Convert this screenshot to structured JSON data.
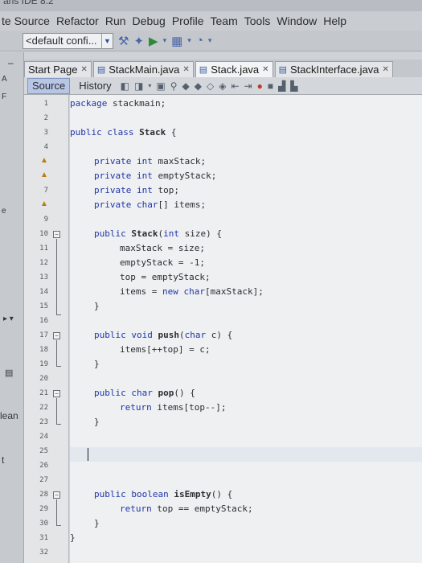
{
  "window_title": "ans IDE 8.2",
  "menu": [
    "te Source",
    "Refactor",
    "Run",
    "Debug",
    "Profile",
    "Team",
    "Tools",
    "Window",
    "Help"
  ],
  "toolbar": {
    "config_value": "<default confi..."
  },
  "left_panel": {
    "label_lean": "lean",
    "label_t": "t",
    "label_e": "e",
    "label_f": "F",
    "label_a": "A"
  },
  "tabs": [
    "Start Page",
    "StackMain.java",
    "Stack.java",
    "StackInterface.java"
  ],
  "editor_tabs": {
    "source": "Source",
    "history": "History"
  },
  "code": {
    "line_numbers": [
      "1",
      "2",
      "3",
      "4",
      "5",
      "6",
      "7",
      "8",
      "9",
      "10",
      "11",
      "12",
      "13",
      "14",
      "15",
      "16",
      "17",
      "18",
      "19",
      "20",
      "21",
      "22",
      "23",
      "24",
      "25",
      "26",
      "27",
      "28",
      "29",
      "30",
      "31",
      "32"
    ],
    "l1_kw": "package",
    "l1_rest": " stackmain;",
    "l3_kw": "public class",
    "l3_name": " Stack",
    "l3_rest": " {",
    "l5_kw": "private int",
    "l5_rest": " maxStack;",
    "l6_kw": "private int",
    "l6_rest": " emptyStack;",
    "l7_kw": "private int",
    "l7_rest": " top;",
    "l8_kw": "private char",
    "l8_rest": "[] items;",
    "l10_kw": "public",
    "l10_name": " Stack",
    "l10_mid": "(",
    "l10_kw2": "int",
    "l10_rest": " size) {",
    "l11": "maxStack = size;",
    "l12": "emptyStack = -1;",
    "l13": "top = emptyStack;",
    "l14_a": "items = ",
    "l14_kw": "new char",
    "l14_b": "[maxStack];",
    "l15": "}",
    "l17_kw": "public void",
    "l17_name": " push",
    "l17_mid": "(",
    "l17_kw2": "char",
    "l17_rest": " c) {",
    "l18": "items[++top] = c;",
    "l19": "}",
    "l21_kw": "public char",
    "l21_name": " pop",
    "l21_rest": "() {",
    "l22_kw": "return",
    "l22_rest": " items[top--];",
    "l23": "}",
    "l27_kw": "public boolean",
    "l27_name": " isEmpty",
    "l27_rest": "() {",
    "l28_kw": "return",
    "l28_rest": " top == emptyStack;",
    "l29": "}",
    "l30": "}"
  }
}
